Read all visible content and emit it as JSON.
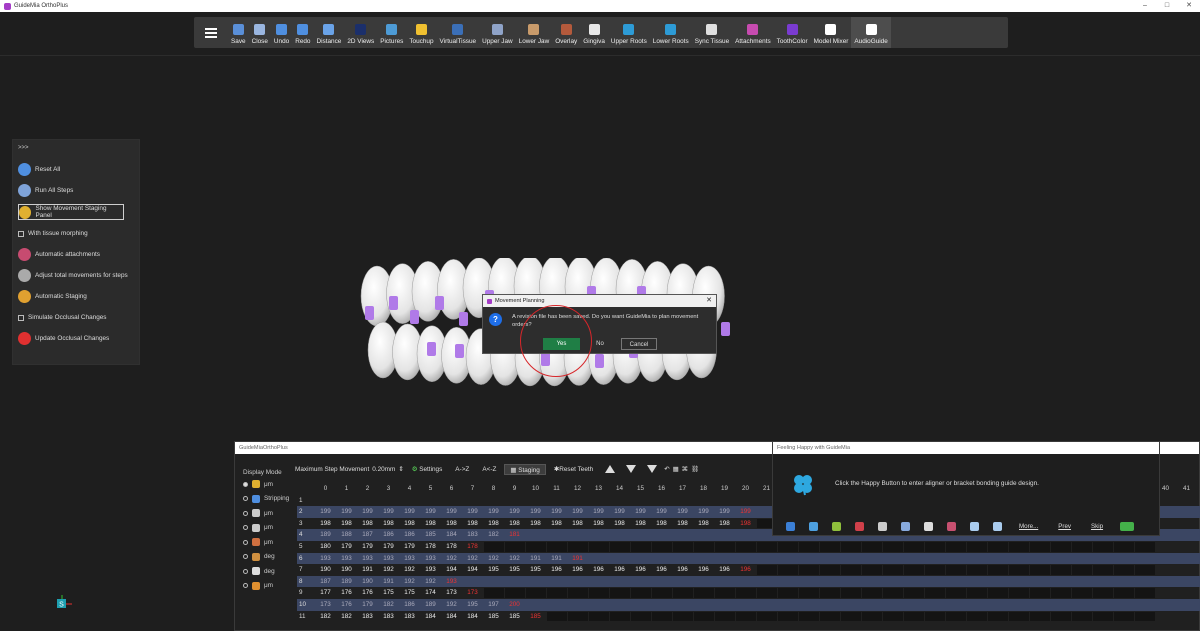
{
  "window": {
    "title": "GuideMia OrthoPlus",
    "controls": [
      "–",
      "□",
      "✕"
    ]
  },
  "toolbar": {
    "items": [
      {
        "label": "Save",
        "icon": "save-icon",
        "color": "#5a8fd8"
      },
      {
        "label": "Close",
        "icon": "close-file-icon",
        "color": "#9ab6e0"
      },
      {
        "label": "Undo",
        "icon": "undo-icon",
        "color": "#4f8fe0"
      },
      {
        "label": "Redo",
        "icon": "redo-icon",
        "color": "#4f8fe0"
      },
      {
        "label": "Distance",
        "icon": "ruler-icon",
        "color": "#6aa3e8"
      },
      {
        "label": "2D Views",
        "icon": "views-icon",
        "color": "#1b2f6b"
      },
      {
        "label": "Pictures",
        "icon": "pictures-icon",
        "color": "#4d9bd6"
      },
      {
        "label": "Touchup",
        "icon": "touchup-icon",
        "color": "#f0c030"
      },
      {
        "label": "VirtualTissue",
        "icon": "tissue-icon",
        "color": "#3b6fb7"
      },
      {
        "label": "Upper Jaw",
        "icon": "upper-jaw-icon",
        "color": "#8fa3c8"
      },
      {
        "label": "Lower Jaw",
        "icon": "lower-jaw-icon",
        "color": "#c99b6b"
      },
      {
        "label": "Overlay",
        "icon": "overlay-icon",
        "color": "#b45a3c"
      },
      {
        "label": "Gingiva",
        "icon": "gingiva-icon",
        "color": "#e8e8e8"
      },
      {
        "label": "Upper Roots",
        "icon": "upper-roots-icon",
        "color": "#2d9bd6"
      },
      {
        "label": "Lower Roots",
        "icon": "lower-roots-icon",
        "color": "#2d9bd6"
      },
      {
        "label": "Sync Tissue",
        "icon": "sync-tissue-icon",
        "color": "#e0e0e0"
      },
      {
        "label": "Attachments",
        "icon": "attachments-icon",
        "color": "#c74bb0"
      },
      {
        "label": "ToothColor",
        "icon": "tooth-color-icon",
        "color": "#7a3bd1"
      },
      {
        "label": "Model Mixer",
        "icon": "model-mixer-icon",
        "color": "#ffffff"
      },
      {
        "label": "AudioGuide",
        "icon": "audio-guide-icon",
        "color": "#ffffff"
      }
    ]
  },
  "left_panel": {
    "chevron": ">>>",
    "items": [
      {
        "label": "Reset All",
        "icon": "reset-icon",
        "color": "#4f8fe0",
        "kind": "button"
      },
      {
        "label": "Run All Steps",
        "icon": "run-steps-icon",
        "color": "#7fa3d8",
        "kind": "button"
      },
      {
        "label": "Show Movement Staging Panel",
        "icon": "staging-panel-icon",
        "color": "#e0b030",
        "kind": "boxed"
      },
      {
        "label": "With tissue morphing",
        "icon": "checkbox-icon",
        "color": "",
        "kind": "checkbox"
      },
      {
        "label": "Automatic attachments",
        "icon": "auto-attach-icon",
        "color": "#c74b70",
        "kind": "button"
      },
      {
        "label": "Adjust total movements for steps",
        "icon": "adjust-icon",
        "color": "#aaaaaa",
        "kind": "button"
      },
      {
        "label": "Automatic Staging",
        "icon": "auto-staging-icon",
        "color": "#e0a030",
        "kind": "button"
      },
      {
        "label": "Simulate Occlusal Changes",
        "icon": "checkbox-icon",
        "color": "",
        "kind": "checkbox"
      },
      {
        "label": "Update Occlusal Changes",
        "icon": "update-icon",
        "color": "#e03030",
        "kind": "button"
      }
    ]
  },
  "dialog": {
    "title": "Movement Planning",
    "message": "A revision file has been saved. Do you want GuideMia to plan movement orders?",
    "yes": "Yes",
    "no": "No",
    "cancel": "Cancel"
  },
  "staging": {
    "title": "GuideMiaOrthoPlus",
    "display_mode": "Display Mode",
    "modes": [
      {
        "label": "μm",
        "selected": true
      },
      {
        "label": "Stripping",
        "selected": false
      },
      {
        "label": "μm",
        "selected": false
      },
      {
        "label": "μm",
        "selected": false
      },
      {
        "label": "μm",
        "selected": false
      },
      {
        "label": "deg",
        "selected": false
      },
      {
        "label": "deg",
        "selected": false
      },
      {
        "label": "μm",
        "selected": false
      }
    ],
    "max_step_label": "Maximum Step Movement",
    "max_step_value": "0.20mm",
    "settings": "Settings",
    "sort_az": "A->Z",
    "sort_za": "A<-Z",
    "staging_btn": "Staging",
    "reset_teeth": "Reset Teeth",
    "columns": [
      "0",
      "1",
      "2",
      "3",
      "4",
      "5",
      "6",
      "7",
      "8",
      "9",
      "10",
      "11",
      "12",
      "13",
      "14",
      "15",
      "16",
      "17",
      "18",
      "19",
      "20",
      "21"
    ],
    "right_columns": [
      "40",
      "41"
    ],
    "rows": [
      {
        "label": "1",
        "values": [],
        "last": ""
      },
      {
        "label": "2",
        "values": [
          "199",
          "199",
          "199",
          "199",
          "199",
          "199",
          "199",
          "199",
          "199",
          "199",
          "199",
          "199",
          "199",
          "199",
          "199",
          "199",
          "199",
          "199",
          "199",
          "199"
        ],
        "last": "199"
      },
      {
        "label": "3",
        "values": [
          "198",
          "198",
          "198",
          "198",
          "198",
          "198",
          "198",
          "198",
          "198",
          "198",
          "198",
          "198",
          "198",
          "198",
          "198",
          "198",
          "198",
          "198",
          "198",
          "198"
        ],
        "last": "198"
      },
      {
        "label": "4",
        "values": [
          "189",
          "188",
          "187",
          "186",
          "186",
          "185",
          "184",
          "183",
          "182"
        ],
        "last": "181"
      },
      {
        "label": "5",
        "values": [
          "180",
          "179",
          "179",
          "179",
          "179",
          "178",
          "178"
        ],
        "last": "178"
      },
      {
        "label": "6",
        "values": [
          "193",
          "193",
          "193",
          "193",
          "193",
          "193",
          "192",
          "192",
          "192",
          "192",
          "191",
          "191"
        ],
        "last": "191"
      },
      {
        "label": "7",
        "values": [
          "190",
          "190",
          "191",
          "192",
          "192",
          "193",
          "194",
          "194",
          "195",
          "195",
          "195",
          "196",
          "196",
          "196",
          "196",
          "196",
          "196",
          "196",
          "196",
          "196"
        ],
        "last": "196"
      },
      {
        "label": "8",
        "values": [
          "187",
          "189",
          "190",
          "191",
          "192",
          "192"
        ],
        "last": "193"
      },
      {
        "label": "9",
        "values": [
          "177",
          "176",
          "176",
          "175",
          "175",
          "174",
          "173"
        ],
        "last": "173"
      },
      {
        "label": "10",
        "values": [
          "173",
          "176",
          "179",
          "182",
          "186",
          "189",
          "192",
          "195",
          "197"
        ],
        "last": "200"
      },
      {
        "label": "11",
        "values": [
          "182",
          "182",
          "183",
          "183",
          "183",
          "184",
          "184",
          "184",
          "185",
          "185"
        ],
        "last": "185"
      }
    ]
  },
  "happy": {
    "title": "Feeling Happy with GuideMia",
    "message": "Click the Happy Button to enter aligner or bracket bonding guide design.",
    "more": "More...",
    "prev": "Prev",
    "skip": "Skip"
  }
}
